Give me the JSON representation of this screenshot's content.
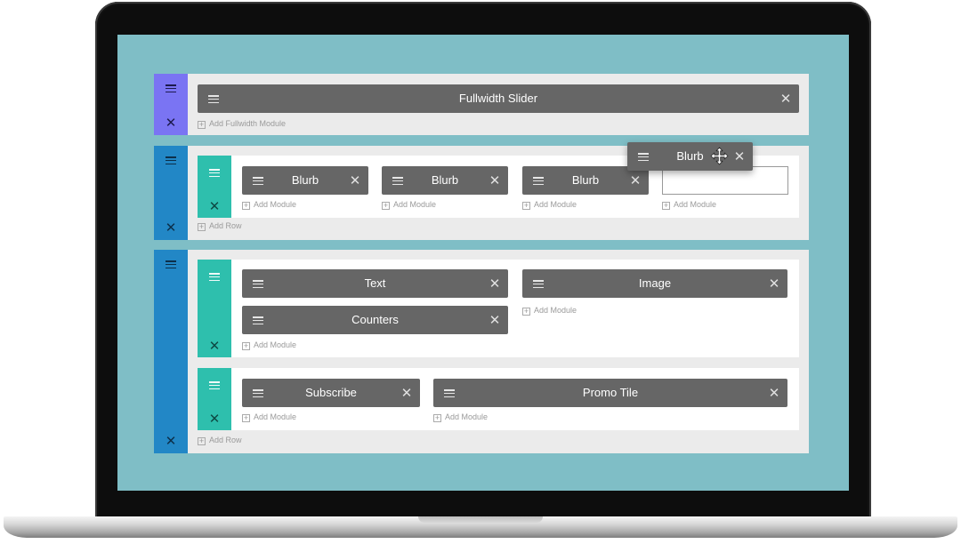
{
  "colors": {
    "screen_bg": "#7fbec6",
    "fullwidth_handle": "#7a74f3",
    "section_handle": "#2287c6",
    "row_handle": "#2ebfad",
    "module_bg": "#666666"
  },
  "icons": {
    "drag": "hamburger-icon",
    "remove": "close-icon",
    "add": "plus-box-icon",
    "move": "move-cursor-icon"
  },
  "sections": [
    {
      "type": "fullwidth",
      "modules": [
        "Fullwidth Slider"
      ],
      "add_label": "Add Fullwidth Module"
    },
    {
      "type": "regular",
      "rows": [
        {
          "columns": [
            {
              "modules": [
                "Blurb"
              ],
              "add_label": "Add Module"
            },
            {
              "modules": [
                "Blurb"
              ],
              "add_label": "Add Module"
            },
            {
              "modules": [
                "Blurb"
              ],
              "add_label": "Add Module"
            },
            {
              "modules": [],
              "add_label": "Add Module"
            }
          ]
        }
      ],
      "add_row_label": "Add Row"
    },
    {
      "type": "regular",
      "rows": [
        {
          "columns": [
            {
              "modules": [
                "Text",
                "Counters"
              ],
              "add_label": "Add Module"
            },
            {
              "modules": [
                "Image"
              ],
              "add_label": "Add Module"
            }
          ]
        },
        {
          "columns": [
            {
              "modules": [
                "Subscribe"
              ],
              "add_label": "Add Module"
            },
            {
              "modules": [
                "Promo Tile"
              ],
              "add_label": "Add Module"
            }
          ]
        }
      ],
      "add_row_label": "Add Row"
    }
  ],
  "dragging_module": {
    "label": "Blurb"
  },
  "close_glyph": "✕"
}
